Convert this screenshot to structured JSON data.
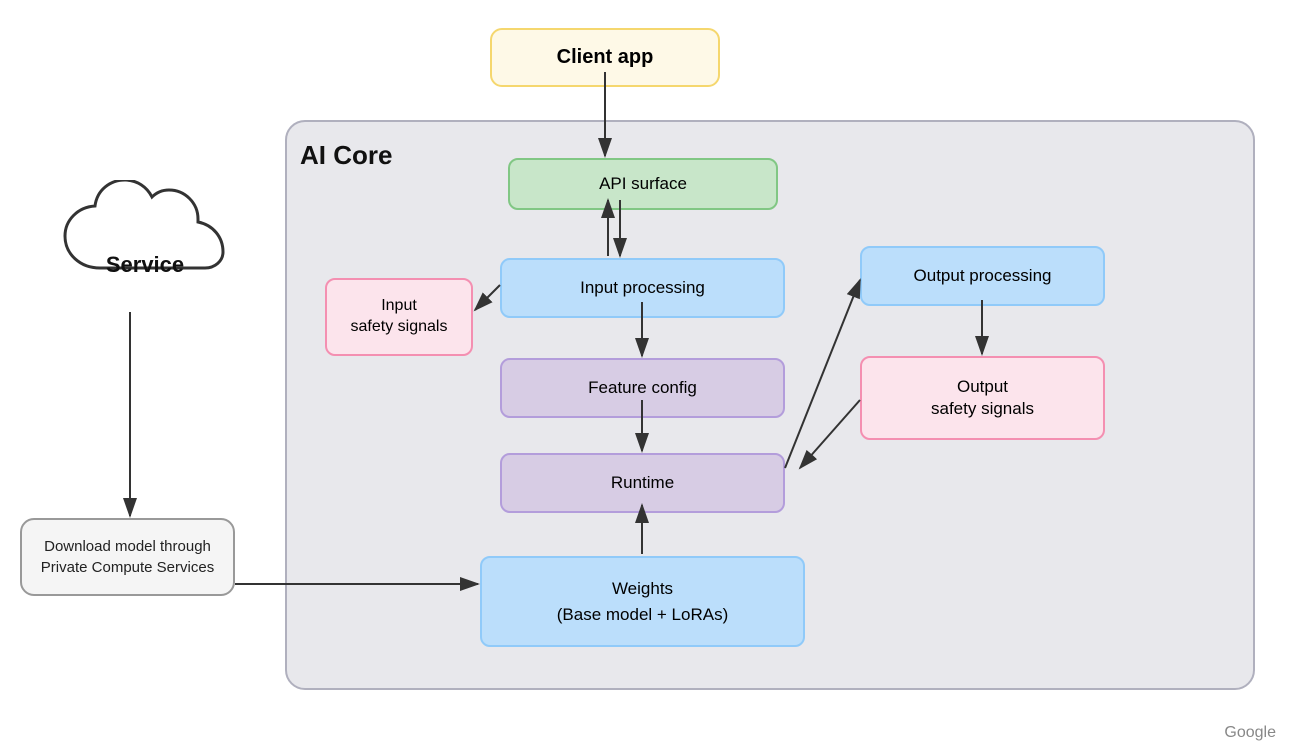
{
  "client_app": {
    "label": "Client app"
  },
  "ai_core": {
    "label": "AI Core"
  },
  "api_surface": {
    "label": "API surface"
  },
  "input_processing": {
    "label": "Input processing"
  },
  "input_safety": {
    "label": "Input\nsafety signals"
  },
  "feature_config": {
    "label": "Feature config"
  },
  "runtime": {
    "label": "Runtime"
  },
  "output_processing": {
    "label": "Output processing"
  },
  "output_safety": {
    "label": "Output\nsafety signals"
  },
  "weights": {
    "label": "Weights\n(Base model + LoRAs)"
  },
  "service": {
    "label": "Service"
  },
  "download": {
    "label": "Download model through Private Compute Services"
  },
  "google": {
    "label": "Google"
  }
}
